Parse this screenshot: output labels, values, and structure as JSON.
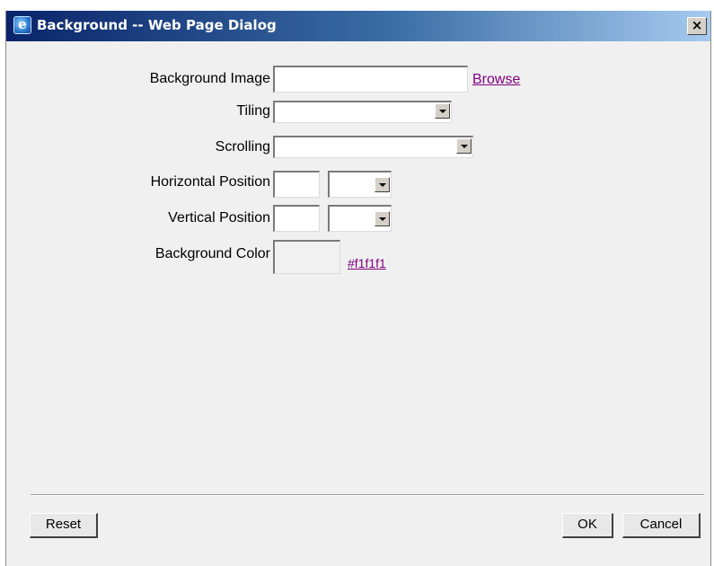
{
  "window": {
    "title": "Background -- Web Page Dialog",
    "close_glyph": "×",
    "icon": "ie-page-icon"
  },
  "form": {
    "background_image": {
      "label": "Background Image",
      "value": "",
      "browse_label": "Browse"
    },
    "tiling": {
      "label": "Tiling",
      "selected": ""
    },
    "scrolling": {
      "label": "Scrolling",
      "selected": ""
    },
    "horizontal_position": {
      "label": "Horizontal Position",
      "value": "",
      "unit_selected": ""
    },
    "vertical_position": {
      "label": "Vertical Position",
      "value": "",
      "unit_selected": ""
    },
    "background_color": {
      "label": "Background Color",
      "swatch_color": "#f1f1f1",
      "color_link": "#f1f1f1"
    }
  },
  "buttons": {
    "reset": "Reset",
    "ok": "OK",
    "cancel": "Cancel"
  },
  "colors": {
    "link": "#800080",
    "dialog_bg": "#f0f0f0",
    "title_start": "#0a246a",
    "title_end": "#a6caf0"
  }
}
